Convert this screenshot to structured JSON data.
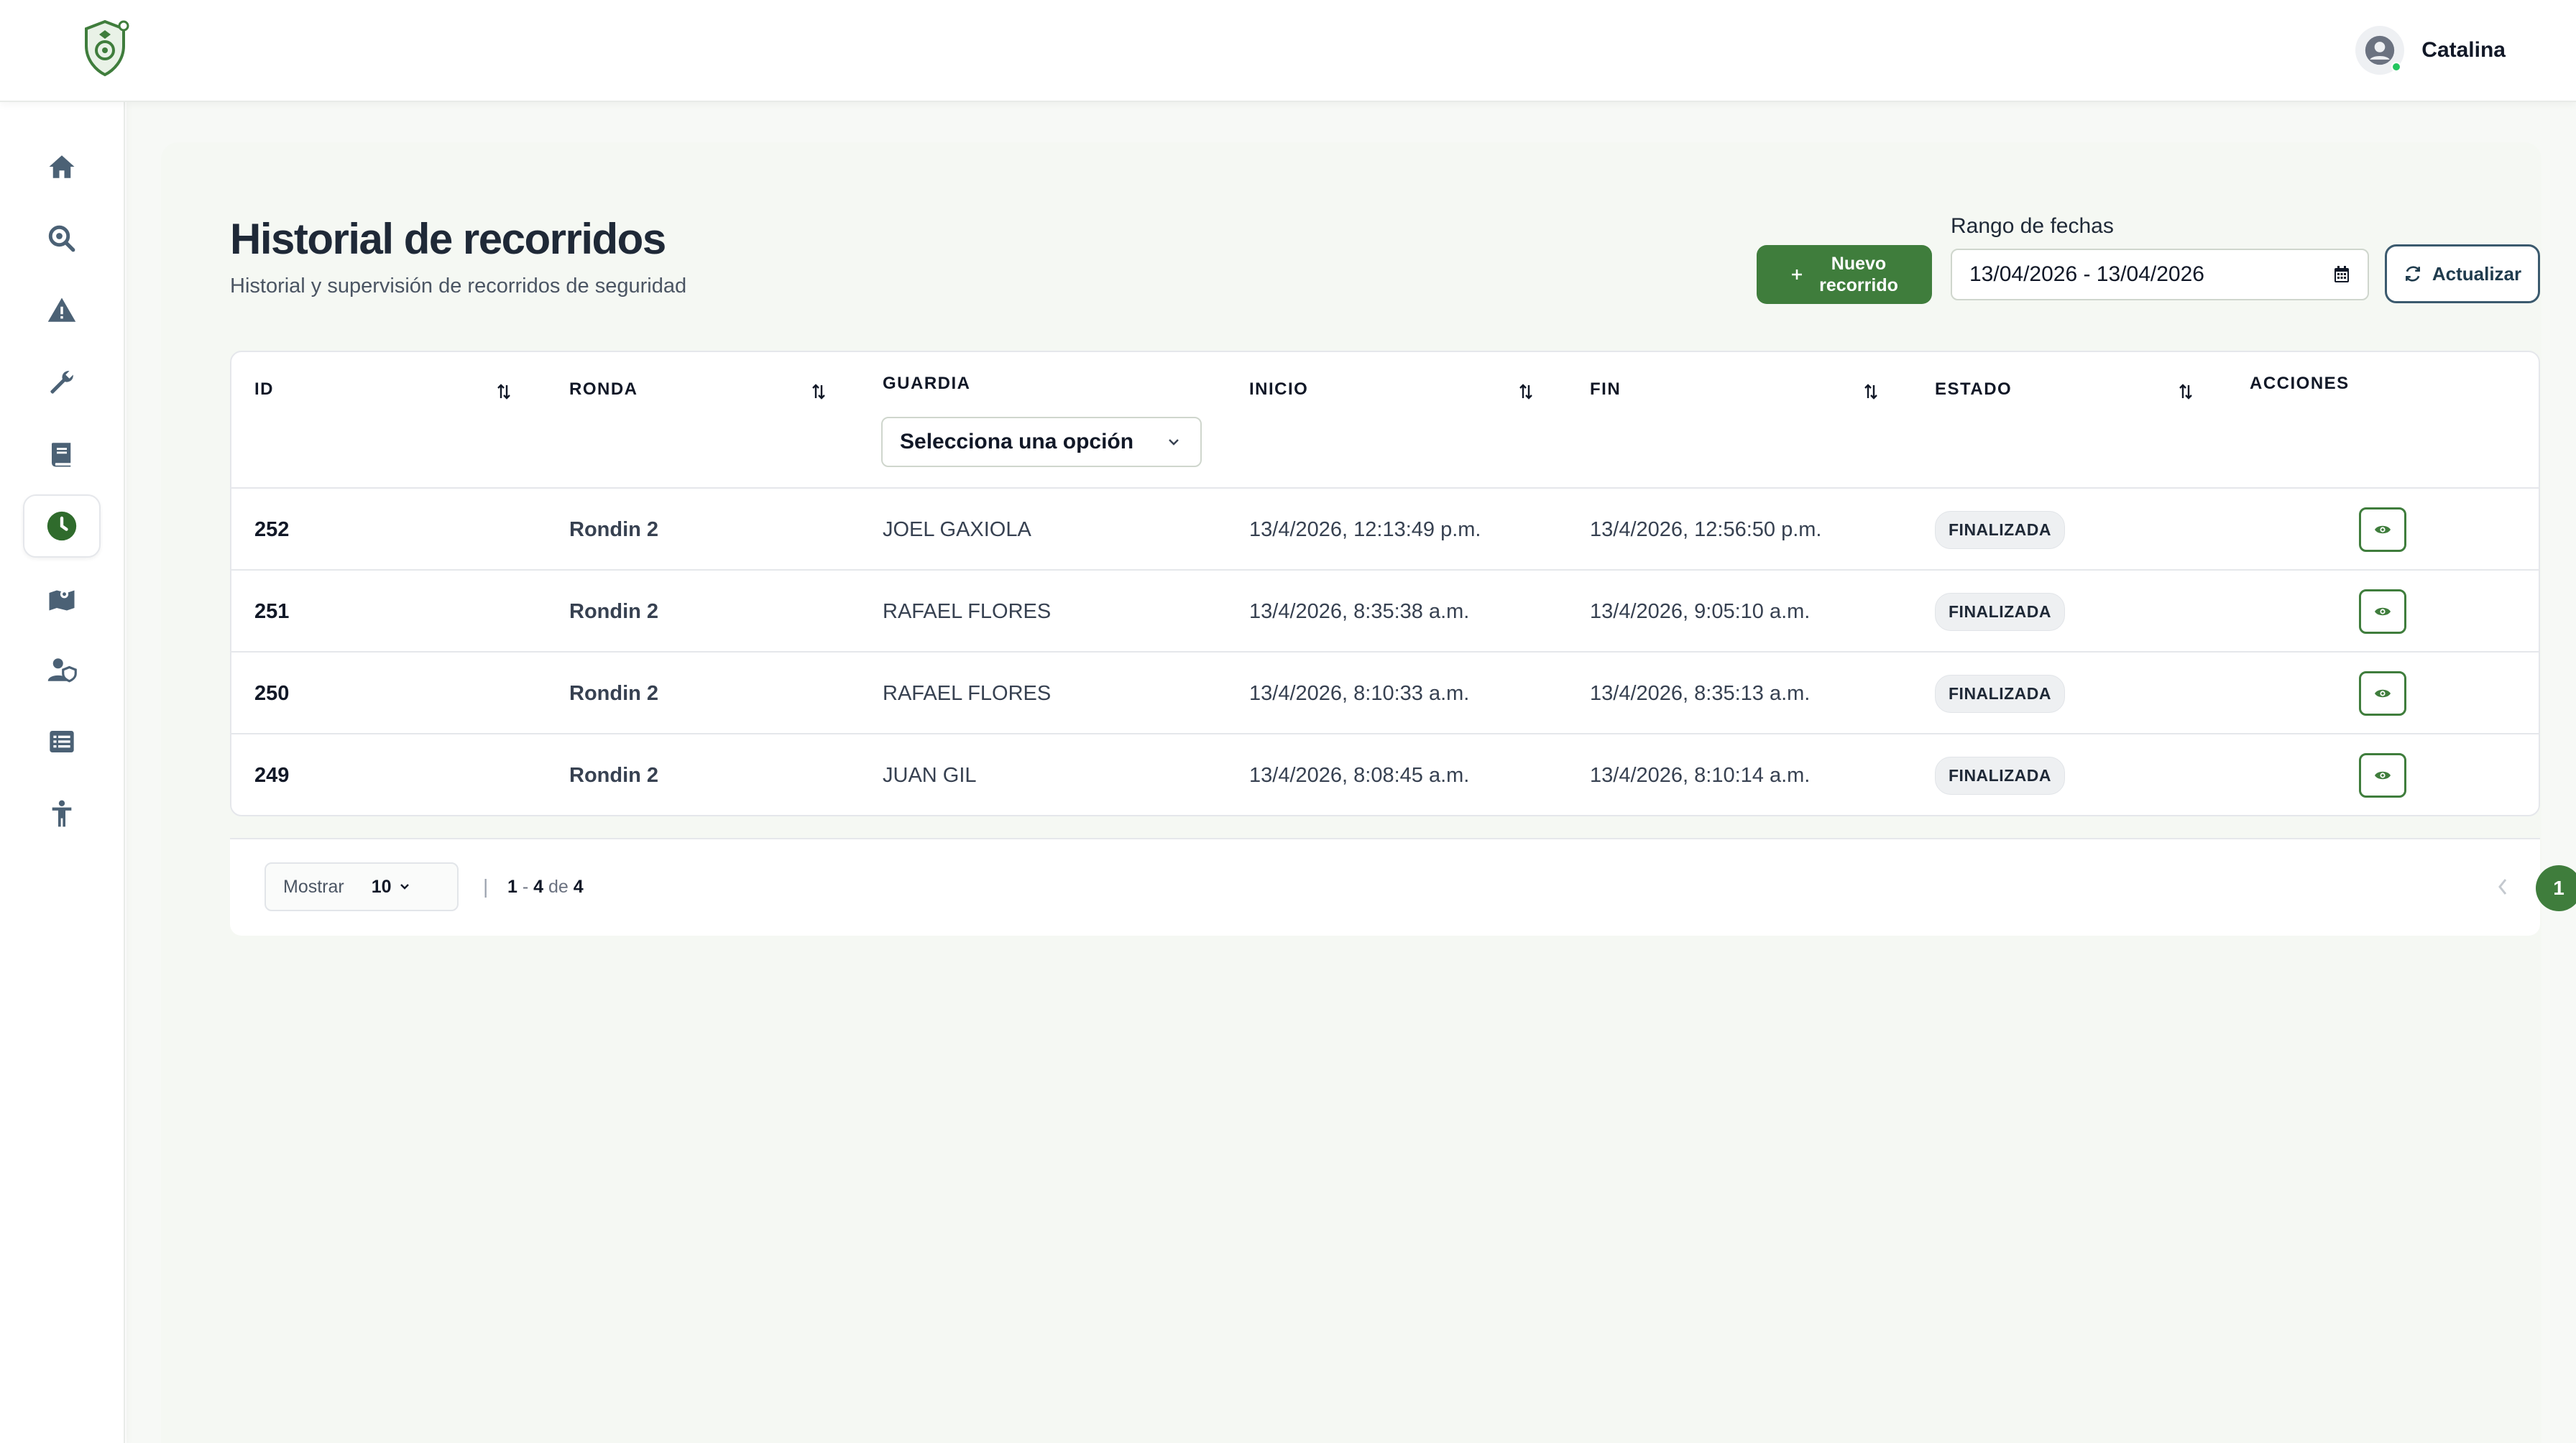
{
  "header": {
    "logo_icon": "shield-logo-icon",
    "user_name": "Catalina"
  },
  "sidebar": {
    "items": [
      {
        "name": "home",
        "icon": "home-icon",
        "active": false
      },
      {
        "name": "search",
        "icon": "search-location-icon",
        "active": false
      },
      {
        "name": "alerts",
        "icon": "warning-icon",
        "active": false
      },
      {
        "name": "tools",
        "icon": "wrench-icon",
        "active": false
      },
      {
        "name": "logbook",
        "icon": "book-icon",
        "active": false
      },
      {
        "name": "history",
        "icon": "clock-icon",
        "active": true
      },
      {
        "name": "map",
        "icon": "map-icon",
        "active": false
      },
      {
        "name": "users",
        "icon": "user-shield-icon",
        "active": false
      },
      {
        "name": "list",
        "icon": "list-icon",
        "active": false
      },
      {
        "name": "person",
        "icon": "person-icon",
        "active": false
      }
    ]
  },
  "page": {
    "title": "Historial de recorridos",
    "subtitle": "Historial y supervisión de recorridos de seguridad"
  },
  "actions": {
    "new_label": "Nuevo recorrido",
    "date_label": "Rango de fechas",
    "date_value": "13/04/2026 - 13/04/2026",
    "refresh_label": "Actualizar"
  },
  "table": {
    "columns": {
      "id": "ID",
      "ronda": "RONDA",
      "guardia": "GUARDIA",
      "inicio": "INICIO",
      "fin": "FIN",
      "estado": "ESTADO",
      "acciones": "ACCIONES"
    },
    "guard_filter_placeholder": "Selecciona una opción",
    "rows": [
      {
        "id": "252",
        "ronda": "Rondin 2",
        "guardia": "JOEL GAXIOLA",
        "inicio": "13/4/2026, 12:13:49 p.m.",
        "fin": "13/4/2026, 12:56:50 p.m.",
        "estado": "FINALIZADA"
      },
      {
        "id": "251",
        "ronda": "Rondin 2",
        "guardia": "RAFAEL FLORES",
        "inicio": "13/4/2026, 8:35:38 a.m.",
        "fin": "13/4/2026, 9:05:10 a.m.",
        "estado": "FINALIZADA"
      },
      {
        "id": "250",
        "ronda": "Rondin 2",
        "guardia": "RAFAEL FLORES",
        "inicio": "13/4/2026, 8:10:33 a.m.",
        "fin": "13/4/2026, 8:35:13 a.m.",
        "estado": "FINALIZADA"
      },
      {
        "id": "249",
        "ronda": "Rondin 2",
        "guardia": "JUAN GIL",
        "inicio": "13/4/2026, 8:08:45 a.m.",
        "fin": "13/4/2026, 8:10:14 a.m.",
        "estado": "FINALIZADA"
      }
    ]
  },
  "pagination": {
    "show_label": "Mostrar",
    "page_size": "10",
    "range_start": "1",
    "range_dash": "-",
    "range_end": "4",
    "range_of": "de",
    "total": "4",
    "current_page": "1",
    "separator": "|"
  },
  "colors": {
    "accent": "#3f7d3c",
    "background": "#f5f8f3",
    "badge_bg": "#eef0f2"
  }
}
